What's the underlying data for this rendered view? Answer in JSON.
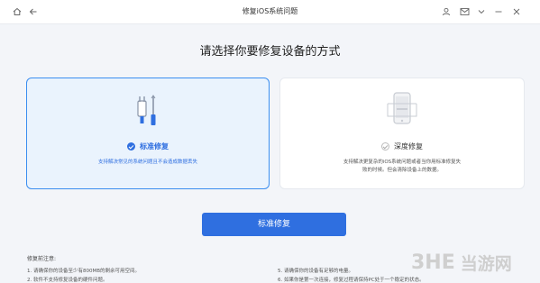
{
  "window": {
    "title": "修复iOS系统问题"
  },
  "page": {
    "heading": "请选择你要修复设备的方式"
  },
  "modes": {
    "standard": {
      "title": "标准修复",
      "description": "支持解决常见的系统问题且不会造成数据丢失",
      "selected": true,
      "icon": "tools-icon"
    },
    "deep": {
      "title": "深度修复",
      "description_line1": "支持解决更复杂的iOS系统问题或者当你用标准修复失",
      "description_line2": "败的时候。但会清除设备上的数据。",
      "selected": false,
      "icon": "phone-icon"
    }
  },
  "action": {
    "label": "标准修复"
  },
  "notes": {
    "title": "修复前注意:",
    "items": [
      "1. 请确保你的设备至少有800MB的剩余可用空间。",
      "2. 软件不支持修复设备的硬件问题。",
      "5. 请确保你的设备有足够的电量。",
      "6. 如果你是第一次连接，修复过程请保持PC处于一个稳定的状态。"
    ]
  },
  "watermark": {
    "logo": "3HE",
    "text": "当游网"
  },
  "colors": {
    "accent": "#2f6fe0",
    "selected_bg": "#eaf3fd",
    "page_bg": "#f3f5f9"
  }
}
